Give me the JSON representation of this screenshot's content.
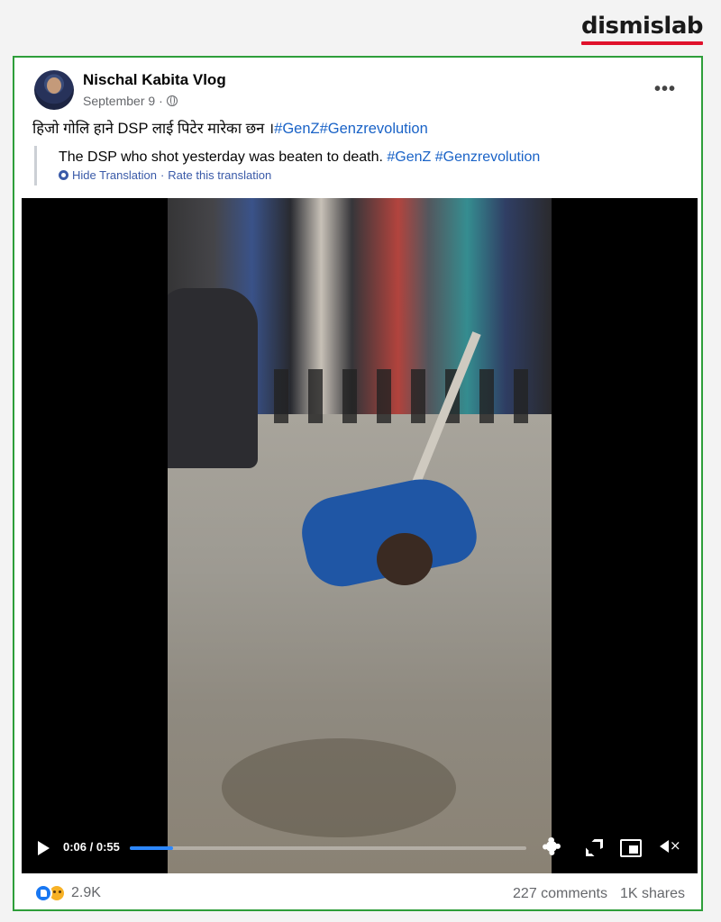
{
  "watermark": {
    "text": "dismislab"
  },
  "post": {
    "author": "Nischal Kabita Vlog",
    "date": "September 9",
    "date_sep": "·",
    "more_label": "•••",
    "text_plain": "हिजो गोलि हाने DSP लाई पिटेर मारेका छन ।",
    "text_tags": [
      "#GenZ",
      "#Genzrevolution"
    ],
    "translation": {
      "text": "The DSP who shot yesterday was beaten to death.",
      "tags": [
        "#GenZ",
        "#Genzrevolution"
      ],
      "hide_label": "Hide Translation",
      "rate_label": "Rate this translation",
      "separator": "·"
    }
  },
  "video": {
    "time": "0:06 / 0:55",
    "progress_fraction": 0.11
  },
  "footer": {
    "reaction_count": "2.9K",
    "comments": "227 comments",
    "shares": "1K shares"
  },
  "colors": {
    "accent": "#1877f2",
    "hashtag": "#1a63c7",
    "border": "#2e9e3a",
    "brand_red": "#e0112b"
  },
  "icons": [
    "globe-icon",
    "translate-gear-icon",
    "play-icon",
    "settings-gear-icon",
    "fullscreen-icon",
    "pip-icon",
    "volume-muted-icon",
    "like-reaction-icon",
    "sad-reaction-icon",
    "more-options-icon"
  ]
}
